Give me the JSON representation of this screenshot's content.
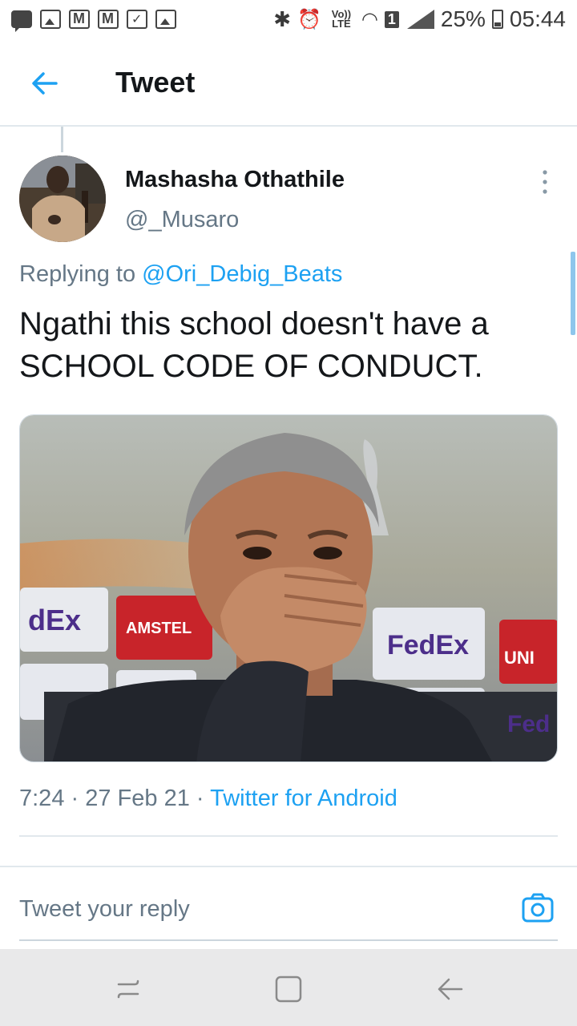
{
  "status_bar": {
    "volte_label": "Vo)) LTE",
    "sim_badge": "1",
    "battery_percent": "25%",
    "time": "05:44"
  },
  "header": {
    "title": "Tweet"
  },
  "tweet": {
    "author_name": "Mashasha Othathile",
    "author_handle": "@_Musaro",
    "replying_prefix": "Replying to",
    "replying_to": "@Ori_Debig_Beats",
    "text": "Ngathi this school doesn't have a SCHOOL CODE OF CONDUCT.",
    "time": "7:24",
    "date": "27 Feb 21",
    "source": "Twitter for Android"
  },
  "reply": {
    "placeholder": "Tweet your reply"
  },
  "colors": {
    "accent": "#1da1f2",
    "secondary_text": "#657786",
    "divider": "#e1e8ed"
  }
}
